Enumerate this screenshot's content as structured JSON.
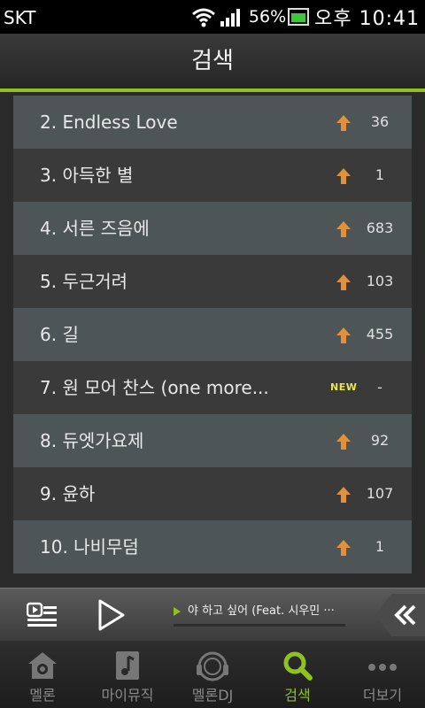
{
  "status_bar": {
    "carrier": "SKT",
    "battery_percent": "56%",
    "time": "오후 10:41"
  },
  "header": {
    "title": "검색"
  },
  "list": {
    "items": [
      {
        "label": "2. Endless Love",
        "trend": "up",
        "count": "36"
      },
      {
        "label": "3. 아득한 별",
        "trend": "up",
        "count": "1"
      },
      {
        "label": "4. 서른 즈음에",
        "trend": "up",
        "count": "683"
      },
      {
        "label": "5. 두근거려",
        "trend": "up",
        "count": "103"
      },
      {
        "label": "6. 길",
        "trend": "up",
        "count": "455"
      },
      {
        "label": "7. 원 모어 찬스 (one more...",
        "trend": "new",
        "badge": "NEW",
        "count": "-"
      },
      {
        "label": "8. 듀엣가요제",
        "trend": "up",
        "count": "92"
      },
      {
        "label": "9. 윤하",
        "trend": "up",
        "count": "107"
      },
      {
        "label": "10. 나비무덤",
        "trend": "up",
        "count": "1"
      }
    ]
  },
  "player": {
    "track": "야 하고 싶어 (Feat. 시우민 ···"
  },
  "tabs": [
    {
      "label": "멜론",
      "icon": "melon-home-icon"
    },
    {
      "label": "마이뮤직",
      "icon": "my-music-icon"
    },
    {
      "label": "멜론DJ",
      "icon": "headphones-icon"
    },
    {
      "label": "검색",
      "icon": "search-icon",
      "active": true
    },
    {
      "label": "더보기",
      "icon": "more-dots-icon"
    }
  ],
  "colors": {
    "accent": "#8fc21f",
    "trend_up": "#e0913a",
    "new_badge": "#e8e84a"
  }
}
